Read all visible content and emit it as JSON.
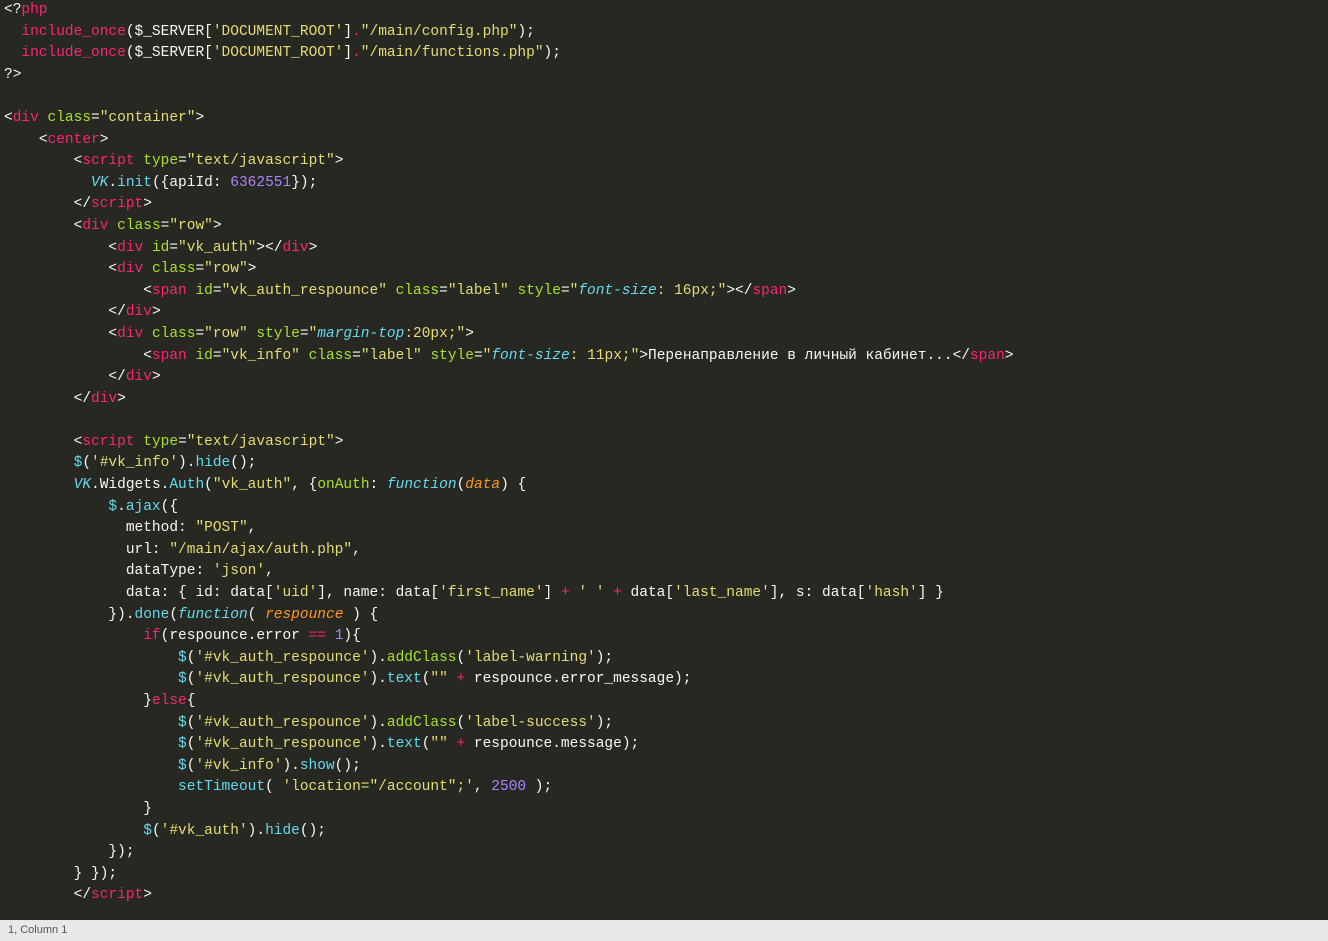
{
  "status": {
    "text": "1, Column 1"
  },
  "code": {
    "t1": "<?",
    "t2": "php",
    "t3": "include_once",
    "t4": "(",
    "t5": "$_SERVER",
    "t6": "[",
    "t7": "'DOCUMENT_ROOT'",
    "t8": "]",
    "t9": ".",
    "t10": "\"/main/config.php\"",
    "t11": ");",
    "t12": "include_once",
    "t13": "(",
    "t14": "$_SERVER",
    "t15": "[",
    "t16": "'DOCUMENT_ROOT'",
    "t17": "]",
    "t18": ".",
    "t19": "\"/main/functions.php\"",
    "t20": ");",
    "t21": "?>",
    "t22": "<",
    "t23": "div",
    "t24": "class",
    "t25": "=",
    "t26": "\"container\"",
    "t27": ">",
    "t28": "<",
    "t29": "center",
    "t30": ">",
    "t31": "<",
    "t32": "script",
    "t33": "type",
    "t34": "=",
    "t35": "\"text/javascript\"",
    "t36": ">",
    "t37": "VK",
    "t38": ".",
    "t39": "init",
    "t40": "({",
    "t41": "apiId",
    "t42": ": ",
    "t43": "6362551",
    "t44": "});",
    "t45": "</",
    "t46": "script",
    "t47": ">",
    "t48": "<",
    "t49": "div",
    "t50": "class",
    "t51": "=",
    "t52": "\"row\"",
    "t53": ">",
    "t54": "<",
    "t55": "div",
    "t56": "id",
    "t57": "=",
    "t58": "\"vk_auth\"",
    "t59": "></",
    "t60": "div",
    "t61": ">",
    "t62": "<",
    "t63": "div",
    "t64": "class",
    "t65": "=",
    "t66": "\"row\"",
    "t67": ">",
    "t68": "<",
    "t69": "span",
    "t70": "id",
    "t71": "=",
    "t72": "\"vk_auth_respounce\"",
    "t73": "class",
    "t74": "=",
    "t75": "\"label\"",
    "t76": "style",
    "t77": "=",
    "t78": "\"",
    "t79": "font-size",
    "t80": ": 16px;",
    "t81": "\"",
    "t82": "></",
    "t83": "span",
    "t84": ">",
    "t85": "</",
    "t86": "div",
    "t87": ">",
    "t88": "<",
    "t89": "div",
    "t90": "class",
    "t91": "=",
    "t92": "\"row\"",
    "t93": "style",
    "t94": "=",
    "t95": "\"",
    "t96": "margin-top",
    "t97": ":20px;",
    "t98": "\"",
    "t99": ">",
    "t100": "<",
    "t101": "span",
    "t102": "id",
    "t103": "=",
    "t104": "\"vk_info\"",
    "t105": "class",
    "t106": "=",
    "t107": "\"label\"",
    "t108": "style",
    "t109": "=",
    "t110": "\"",
    "t111": "font-size",
    "t112": ": 11px;",
    "t113": "\"",
    "t114": ">",
    "t115": "Перенаправление в личный кабинет...",
    "t116": "</",
    "t117": "span",
    "t118": ">",
    "t119": "</",
    "t120": "div",
    "t121": ">",
    "t122": "</",
    "t123": "div",
    "t124": ">",
    "t125": "<",
    "t126": "script",
    "t127": "type",
    "t128": "=",
    "t129": "\"text/javascript\"",
    "t130": ">",
    "t131": "$",
    "t132": "(",
    "t133": "'#vk_info'",
    "t134": ").",
    "t135": "hide",
    "t136": "();",
    "t137": "VK",
    "t138": ".Widgets.",
    "t139": "Auth",
    "t140": "(",
    "t141": "\"vk_auth\"",
    "t142": ", {",
    "t143": "onAuth",
    "t144": ": ",
    "t145": "function",
    "t146": "(",
    "t147": "data",
    "t148": ") {",
    "t149": "$",
    "t150": ".",
    "t151": "ajax",
    "t152": "({",
    "t153": "method: ",
    "t154": "\"POST\"",
    "t155": ",",
    "t156": "url: ",
    "t157": "\"/main/ajax/auth.php\"",
    "t158": ",",
    "t159": "dataType: ",
    "t160": "'json'",
    "t161": ",",
    "t162": "data: { id: data[",
    "t163": "'uid'",
    "t164": "], name: data[",
    "t165": "'first_name'",
    "t166": "] ",
    "t167": "+",
    "t168": " ",
    "t169": "' '",
    "t170": " ",
    "t171": "+",
    "t172": " data[",
    "t173": "'last_name'",
    "t174": "], s: data[",
    "t175": "'hash'",
    "t176": "] }",
    "t177": "}).",
    "t178": "done",
    "t179": "(",
    "t180": "function",
    "t181": "( ",
    "t182": "respounce",
    "t183": " ) {",
    "t184": "if",
    "t185": "(respounce.error ",
    "t186": "==",
    "t187": " ",
    "t188": "1",
    "t189": "){",
    "t190": "$",
    "t191": "(",
    "t192": "'#vk_auth_respounce'",
    "t193": ").",
    "t194": "addClass",
    "t195": "(",
    "t196": "'label-warning'",
    "t197": ");",
    "t198": "$",
    "t199": "(",
    "t200": "'#vk_auth_respounce'",
    "t201": ").",
    "t202": "text",
    "t203": "(",
    "t204": "\"\"",
    "t205": " ",
    "t206": "+",
    "t207": " respounce.error_message);",
    "t208": "}",
    "t209": "else",
    "t210": "{",
    "t211": "$",
    "t212": "(",
    "t213": "'#vk_auth_respounce'",
    "t214": ").",
    "t215": "addClass",
    "t216": "(",
    "t217": "'label-success'",
    "t218": ");",
    "t219": "$",
    "t220": "(",
    "t221": "'#vk_auth_respounce'",
    "t222": ").",
    "t223": "text",
    "t224": "(",
    "t225": "\"\"",
    "t226": " ",
    "t227": "+",
    "t228": " respounce.message);",
    "t229": "$",
    "t230": "(",
    "t231": "'#vk_info'",
    "t232": ").",
    "t233": "show",
    "t234": "();",
    "t235": "setTimeout",
    "t236": "( ",
    "t237": "'location=\"/account\";'",
    "t238": ", ",
    "t239": "2500",
    "t240": " );",
    "t241": "}",
    "t242": "$",
    "t243": "(",
    "t244": "'#vk_auth'",
    "t245": ").",
    "t246": "hide",
    "t247": "();",
    "t248": "});",
    "t249": "} });",
    "t250": "</",
    "t251": "script",
    "t252": ">"
  }
}
